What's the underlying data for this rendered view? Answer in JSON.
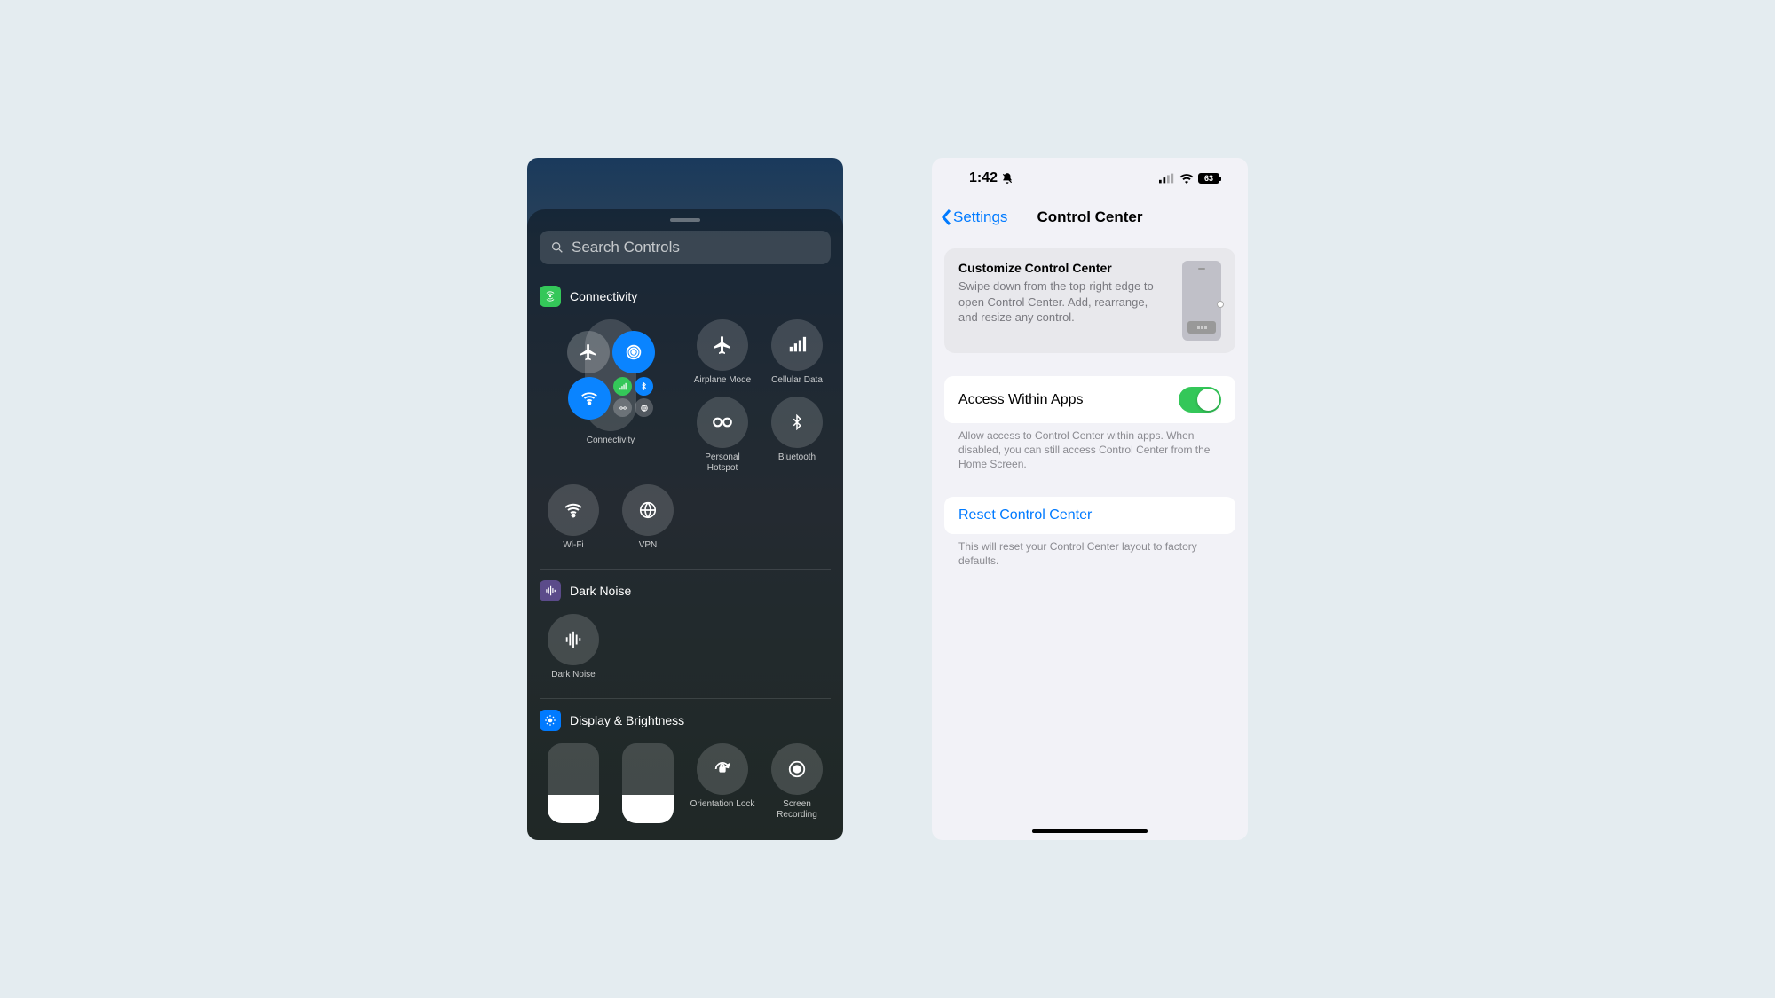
{
  "left": {
    "search_placeholder": "Search Controls",
    "sections": {
      "connectivity": {
        "title": "Connectivity",
        "items": {
          "connectivity": "Connectivity",
          "airplane": "Airplane Mode",
          "cellular": "Cellular Data",
          "hotspot": "Personal Hotspot",
          "bluetooth": "Bluetooth",
          "wifi": "Wi-Fi",
          "vpn": "VPN"
        }
      },
      "darknoise": {
        "title": "Dark Noise",
        "item": "Dark Noise"
      },
      "display": {
        "title": "Display & Brightness",
        "items": {
          "orientation": "Orientation Lock",
          "recording": "Screen Recording"
        }
      }
    }
  },
  "right": {
    "status": {
      "time": "1:42",
      "battery": "63"
    },
    "nav": {
      "back": "Settings",
      "title": "Control Center"
    },
    "card": {
      "title": "Customize Control Center",
      "desc": "Swipe down from the top-right edge to open Control Center. Add, rearrange, and resize any control."
    },
    "access": {
      "label": "Access Within Apps",
      "footer": "Allow access to Control Center within apps. When disabled, you can still access Control Center from the Home Screen."
    },
    "reset": {
      "label": "Reset Control Center",
      "footer": "This will reset your Control Center layout to factory defaults."
    }
  }
}
